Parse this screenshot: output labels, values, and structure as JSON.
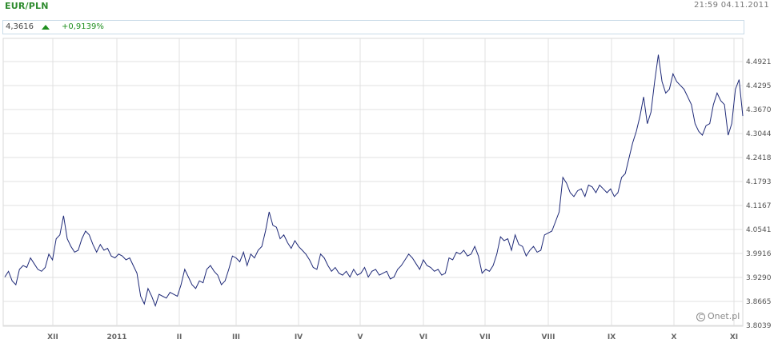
{
  "header": {
    "title": "EUR/PLN",
    "timestamp": "21:59 04.11.2011"
  },
  "quote": {
    "price": "4,3616",
    "change": "+0,9139%",
    "direction": "up-arrow-icon"
  },
  "credit": "Onet.pl",
  "colors": {
    "line": "#1f2a78",
    "title": "#2e8b2e",
    "up": "#1f8f1f",
    "grid": "#e0e0e0"
  },
  "chart_data": {
    "type": "line",
    "title": "EUR/PLN",
    "ylim": [
      3.8039,
      5.0
    ],
    "y_ticks": [
      "4.4921",
      "4.4295",
      "4.3670",
      "4.3044",
      "4.2418",
      "4.1793",
      "4.1167",
      "4.0541",
      "3.9916",
      "3.9290",
      "3.8665",
      "3.8039"
    ],
    "x_labels": [
      "XII",
      "2011",
      "II",
      "III",
      "IV",
      "V",
      "VI",
      "VII",
      "VIII",
      "IX",
      "X",
      "XI"
    ],
    "series": [
      {
        "name": "EUR/PLN",
        "values": [
          3.93,
          3.945,
          3.92,
          3.91,
          3.95,
          3.96,
          3.955,
          3.98,
          3.965,
          3.95,
          3.945,
          3.955,
          3.99,
          3.975,
          4.03,
          4.04,
          4.09,
          4.03,
          4.01,
          3.995,
          4.0,
          4.03,
          4.05,
          4.04,
          4.015,
          3.995,
          4.015,
          4.0,
          4.005,
          3.985,
          3.98,
          3.99,
          3.985,
          3.975,
          3.98,
          3.96,
          3.94,
          3.88,
          3.86,
          3.9,
          3.88,
          3.855,
          3.885,
          3.88,
          3.875,
          3.89,
          3.885,
          3.88,
          3.91,
          3.95,
          3.93,
          3.91,
          3.9,
          3.92,
          3.915,
          3.95,
          3.96,
          3.945,
          3.935,
          3.91,
          3.92,
          3.95,
          3.985,
          3.98,
          3.97,
          3.995,
          3.96,
          3.99,
          3.98,
          4.0,
          4.01,
          4.05,
          4.1,
          4.065,
          4.06,
          4.03,
          4.04,
          4.02,
          4.005,
          4.025,
          4.01,
          4.0,
          3.99,
          3.975,
          3.955,
          3.95,
          3.99,
          3.98,
          3.96,
          3.945,
          3.955,
          3.94,
          3.935,
          3.945,
          3.93,
          3.95,
          3.935,
          3.94,
          3.955,
          3.93,
          3.945,
          3.95,
          3.935,
          3.94,
          3.945,
          3.925,
          3.93,
          3.95,
          3.96,
          3.975,
          3.99,
          3.98,
          3.965,
          3.95,
          3.975,
          3.96,
          3.955,
          3.945,
          3.95,
          3.935,
          3.94,
          3.98,
          3.975,
          3.995,
          3.99,
          4.0,
          3.985,
          3.99,
          4.01,
          3.985,
          3.94,
          3.95,
          3.945,
          3.96,
          3.99,
          4.035,
          4.025,
          4.03,
          4.0,
          4.04,
          4.015,
          4.01,
          3.985,
          4.0,
          4.01,
          3.995,
          4.0,
          4.04,
          4.045,
          4.05,
          4.075,
          4.1,
          4.19,
          4.175,
          4.15,
          4.14,
          4.155,
          4.16,
          4.14,
          4.17,
          4.165,
          4.15,
          4.17,
          4.16,
          4.15,
          4.16,
          4.14,
          4.15,
          4.19,
          4.2,
          4.24,
          4.28,
          4.31,
          4.35,
          4.4,
          4.33,
          4.36,
          4.44,
          4.51,
          4.44,
          4.41,
          4.42,
          4.46,
          4.44,
          4.43,
          4.42,
          4.4,
          4.38,
          4.33,
          4.31,
          4.3,
          4.325,
          4.33,
          4.38,
          4.41,
          4.39,
          4.38,
          4.3,
          4.33,
          4.42,
          4.445,
          4.35
        ]
      }
    ],
    "grid": true
  }
}
